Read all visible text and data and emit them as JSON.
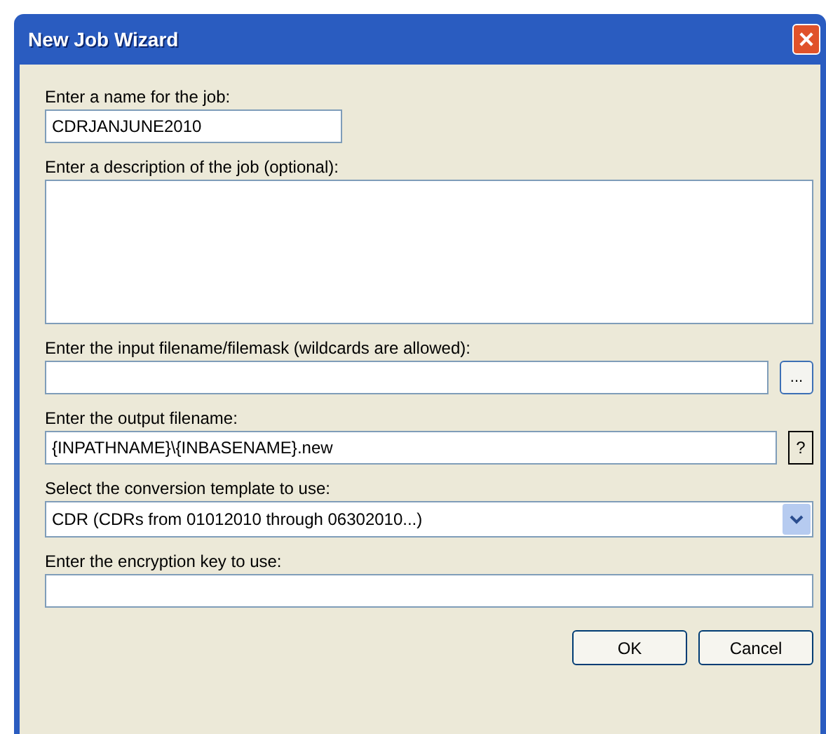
{
  "window": {
    "title": "New Job Wizard"
  },
  "fields": [
    {
      "kind": "short",
      "label": "Enter a name for the job:",
      "value": "CDRJANJUNE2010"
    },
    {
      "kind": "textarea",
      "label": "Enter a description of the job (optional):"
    },
    {
      "kind": "browse",
      "label": "Enter the input filename/filemask (wildcards are allowed):",
      "button": "..."
    },
    {
      "kind": "help",
      "label": "Enter the output filename:",
      "value": "{INPATHNAME}\\{INBASENAME}.new",
      "button": "?"
    },
    {
      "kind": "select",
      "label": "Select the conversion template to use:",
      "value": "CDR (CDRs from 01012010 through 06302010...)"
    },
    {
      "kind": "text",
      "label": "Enter the encryption key to use:"
    }
  ],
  "buttons": [
    "OK",
    "Cancel"
  ]
}
